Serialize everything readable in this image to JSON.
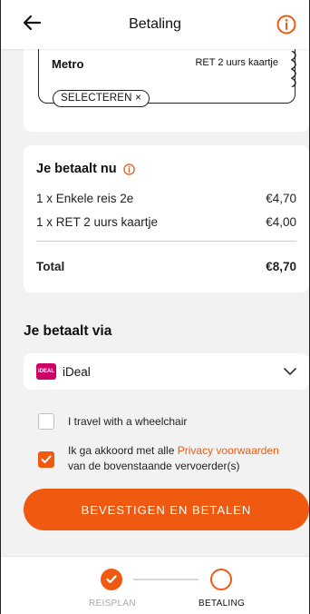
{
  "header": {
    "title": "Betaling",
    "back_icon": "arrow-left-icon",
    "info_icon": "info-icon"
  },
  "ticket": {
    "mode": "Metro",
    "type": "RET 2 uurs kaartje",
    "select_label": "SELECTEREN ×"
  },
  "summary": {
    "title": "Je betaalt nu",
    "items": [
      {
        "label": "1 x Enkele reis 2e",
        "price": "€4,70"
      },
      {
        "label": "1 x RET 2 uurs kaartje",
        "price": "€4,00"
      }
    ],
    "total_label": "Total",
    "total_value": "€8,70"
  },
  "payment": {
    "heading": "Je betaalt via",
    "method": "iDeal",
    "logo_text": "iDEAL"
  },
  "options": {
    "wheelchair_label": "I travel with a wheelchair",
    "wheelchair_checked": false,
    "terms_prefix": "Ik ga akkoord met alle ",
    "terms_link": "Privacy voorwaarden",
    "terms_suffix": "van de bovenstaande vervoerder(s)",
    "terms_checked": true
  },
  "confirm_label": "BEVESTIGEN EN BETALEN",
  "stepper": {
    "steps": [
      {
        "label": "REISPLAN",
        "state": "done"
      },
      {
        "label": "BETALING",
        "state": "current"
      }
    ]
  },
  "colors": {
    "accent": "#ef5a10",
    "ideal": "#cc0066"
  }
}
